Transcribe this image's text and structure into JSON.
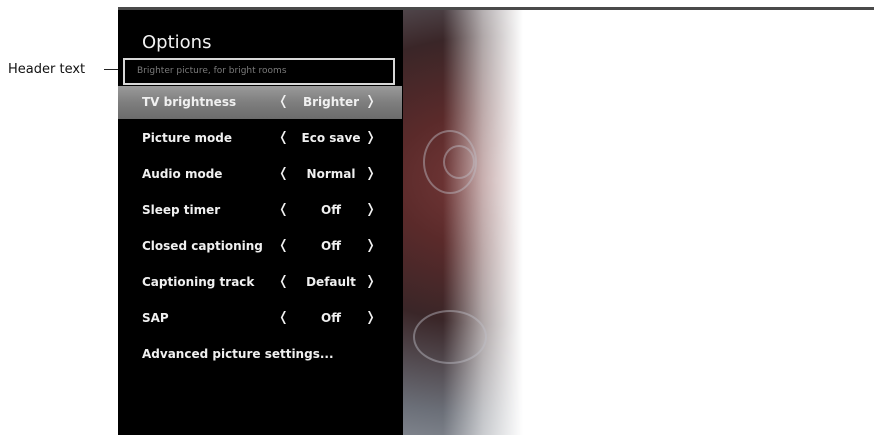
{
  "callout": {
    "label": "Header text"
  },
  "menu": {
    "title": "Options",
    "header_text": "Brighter picture, for bright rooms",
    "arrow_left": "❬",
    "arrow_right": "❭",
    "items": [
      {
        "label": "TV brightness",
        "value": "Brighter",
        "selected": true
      },
      {
        "label": "Picture mode",
        "value": "Eco save"
      },
      {
        "label": "Audio mode",
        "value": "Normal"
      },
      {
        "label": "Sleep timer",
        "value": "Off"
      },
      {
        "label": "Closed captioning",
        "value": "Off"
      },
      {
        "label": "Captioning track",
        "value": "Default"
      },
      {
        "label": "SAP",
        "value": "Off"
      },
      {
        "label": "Advanced picture settings..."
      }
    ]
  }
}
